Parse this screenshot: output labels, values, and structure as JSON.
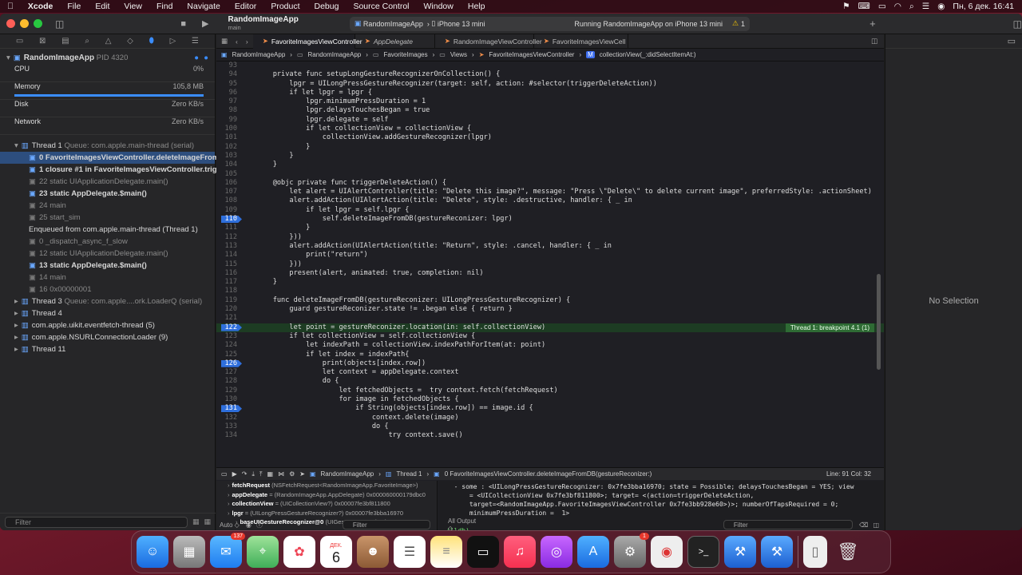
{
  "menubar": {
    "app": "Xcode",
    "items": [
      "File",
      "Edit",
      "View",
      "Find",
      "Navigate",
      "Editor",
      "Product",
      "Debug",
      "Source Control",
      "Window",
      "Help"
    ],
    "datetime": "Пн, 6 дек.  16:41"
  },
  "toolbar": {
    "project": "RandomImageApp",
    "branch": "main",
    "scheme": "RandomImageApp",
    "device": "iPhone 13 mini",
    "status": "Running RandomImageApp on iPhone 13 mini",
    "warnings": "1"
  },
  "navigator": {
    "process": "RandomImageApp",
    "pid": "PID 4320",
    "gauges": [
      {
        "name": "CPU",
        "value": "0%"
      },
      {
        "name": "Memory",
        "value": "105,8 MB"
      },
      {
        "name": "Disk",
        "value": "Zero KB/s"
      },
      {
        "name": "Network",
        "value": "Zero KB/s"
      }
    ],
    "thread1": {
      "name": "Thread 1",
      "queue": "Queue: com.apple.main-thread (serial)"
    },
    "frames": [
      {
        "t": "0 FavoriteImagesViewController.deleteImageFrom...",
        "dim": false,
        "sel": true
      },
      {
        "t": "1 closure #1 in FavoriteImagesViewController.trigg...",
        "dim": false
      },
      {
        "t": "22 static UIApplicationDelegate.main()",
        "dim": true
      },
      {
        "t": "23 static AppDelegate.$main()",
        "dim": false
      },
      {
        "t": "24 main",
        "dim": true
      },
      {
        "t": "25 start_sim",
        "dim": true
      }
    ],
    "enqueued": "Enqueued from com.apple.main-thread (Thread 1)",
    "frames2": [
      {
        "t": "0 _dispatch_async_f_slow",
        "dim": true
      },
      {
        "t": "12 static UIApplicationDelegate.main()",
        "dim": true
      },
      {
        "t": "13 static AppDelegate.$main()",
        "dim": false
      },
      {
        "t": "14 main",
        "dim": true
      },
      {
        "t": "16 0x00000001",
        "dim": true
      }
    ],
    "threads": [
      {
        "t": "Thread 3",
        "q": "Queue: com.apple....ork.LoaderQ (serial)"
      },
      {
        "t": "Thread 4",
        "q": ""
      },
      {
        "t": "com.apple.uikit.eventfetch-thread (5)",
        "q": ""
      },
      {
        "t": "com.apple.NSURLConnectionLoader (9)",
        "q": ""
      },
      {
        "t": "Thread 11",
        "q": ""
      }
    ],
    "filter_placeholder": "Filter"
  },
  "editor": {
    "tabs": [
      "FavoriteImagesViewController",
      "AppDelegate",
      "RandomImageViewController",
      "FavoriteImagesViewCell"
    ],
    "jumpbar": [
      "RandomImageApp",
      "RandomImageApp",
      "FavoriteImages",
      "Views",
      "FavoriteImagesViewController",
      "collectionView(_:didSelectItemAt:)"
    ],
    "breakpoint_label": "Thread 1: breakpoint 4.1 (1)",
    "lines": [
      {
        "n": "93",
        "c": ""
      },
      {
        "n": "94",
        "c": "    private func setupLongGestureRecognizerOnCollection() {"
      },
      {
        "n": "95",
        "c": "        lpgr = UILongPressGestureRecognizer(target: self, action: #selector(triggerDeleteAction))"
      },
      {
        "n": "96",
        "c": "        if let lpgr = lpgr {"
      },
      {
        "n": "97",
        "c": "            lpgr.minimumPressDuration = 1"
      },
      {
        "n": "98",
        "c": "            lpgr.delaysTouchesBegan = true"
      },
      {
        "n": "99",
        "c": "            lpgr.delegate = self"
      },
      {
        "n": "100",
        "c": "            if let collectionView = collectionView {"
      },
      {
        "n": "101",
        "c": "                collectionView.addGestureRecognizer(lpgr)"
      },
      {
        "n": "102",
        "c": "            }"
      },
      {
        "n": "103",
        "c": "        }"
      },
      {
        "n": "104",
        "c": "    }"
      },
      {
        "n": "105",
        "c": ""
      },
      {
        "n": "106",
        "c": "    @objc private func triggerDeleteAction() {"
      },
      {
        "n": "107",
        "c": "        let alert = UIAlertController(title: \"Delete this image?\", message: \"Press \\\"Delete\\\" to delete current image\", preferredStyle: .actionSheet)"
      },
      {
        "n": "108",
        "c": "        alert.addAction(UIAlertAction(title: \"Delete\", style: .destructive, handler: { _ in"
      },
      {
        "n": "109",
        "c": "            if let lpgr = self.lpgr {"
      },
      {
        "n": "110",
        "c": "                self.deleteImageFromDB(gestureReconizer: lpgr)",
        "bp": true
      },
      {
        "n": "111",
        "c": "            }"
      },
      {
        "n": "112",
        "c": "        }))"
      },
      {
        "n": "113",
        "c": "        alert.addAction(UIAlertAction(title: \"Return\", style: .cancel, handler: { _ in"
      },
      {
        "n": "114",
        "c": "            print(\"return\")"
      },
      {
        "n": "115",
        "c": "        }))"
      },
      {
        "n": "116",
        "c": "        present(alert, animated: true, completion: nil)"
      },
      {
        "n": "117",
        "c": "    }"
      },
      {
        "n": "118",
        "c": ""
      },
      {
        "n": "119",
        "c": "    func deleteImageFromDB(gestureReconizer: UILongPressGestureRecognizer) {"
      },
      {
        "n": "120",
        "c": "        guard gestureReconizer.state != .began else { return }"
      },
      {
        "n": "121",
        "c": ""
      },
      {
        "n": "122",
        "c": "        let point = gestureReconizer.location(in: self.collectionView)",
        "bp": true,
        "hl": true
      },
      {
        "n": "123",
        "c": "        if let collectionView = self.collectionView {"
      },
      {
        "n": "124",
        "c": "            let indexPath = collectionView.indexPathForItem(at: point)"
      },
      {
        "n": "125",
        "c": "            if let index = indexPath{"
      },
      {
        "n": "126",
        "c": "                print(objects[index.row])",
        "bp": true
      },
      {
        "n": "127",
        "c": "                let context = appDelegate.context"
      },
      {
        "n": "128",
        "c": "                do {"
      },
      {
        "n": "129",
        "c": "                    let fetchedObjects =  try context.fetch(fetchRequest)"
      },
      {
        "n": "130",
        "c": "                    for image in fetchedObjects {"
      },
      {
        "n": "131",
        "c": "                        if String(objects[index.row]) == image.id {",
        "bp": true
      },
      {
        "n": "132",
        "c": "                            context.delete(image)"
      },
      {
        "n": "133",
        "c": "                            do {"
      },
      {
        "n": "134",
        "c": "                                try context.save()"
      }
    ]
  },
  "debugbar": {
    "target": "RandomImageApp",
    "thread": "Thread 1",
    "frame": "0 FavoriteImagesViewController.deleteImageFromDB(gestureReconizer:)",
    "position": "Line: 91  Col: 32"
  },
  "variables": [
    {
      "n": "fetchRequest",
      "t": "(NSFetchRequest<RandomImageApp.FavoriteImage>)"
    },
    {
      "n": "appDelegate",
      "t": "= (RandomImageApp.AppDelegate) 0x000060000179dbc0"
    },
    {
      "n": "collectionView",
      "t": "= (UICollectionView?) 0x00007fe3bf811800"
    },
    {
      "n": "lpgr",
      "t": "= (UILongPressGestureRecognizer?) 0x00007fe3bba16970"
    },
    {
      "n": "baseUIGestureRecognizer@0",
      "t": "(UIGestureRecognizer)"
    }
  ],
  "console": [
    "  - some : <UILongPressGestureRecognizer: 0x7fe3bba16970; state = Possible; delaysTouchesBegan = YES; view",
    "      = <UICollectionView 0x7fe3bf811800>; target= <(action=triggerDeleteAction,",
    "      target=<RandomImageApp.FavoriteImagesViewController 0x7fe3bb928e60>)>; numberOfTapsRequired = 0;",
    "      minimumPressDuration =  1>",
    "",
    "(lldb)"
  ],
  "bottom": {
    "auto": "Auto ◇",
    "filter": "Filter",
    "output": "All Output ◇",
    "filter2": "Filter"
  },
  "inspector": {
    "empty": "No Selection"
  },
  "dock": {
    "mail_badge": "137",
    "calendar_month": "ДЕК.",
    "calendar_day": "6",
    "settings_badge": "1"
  }
}
